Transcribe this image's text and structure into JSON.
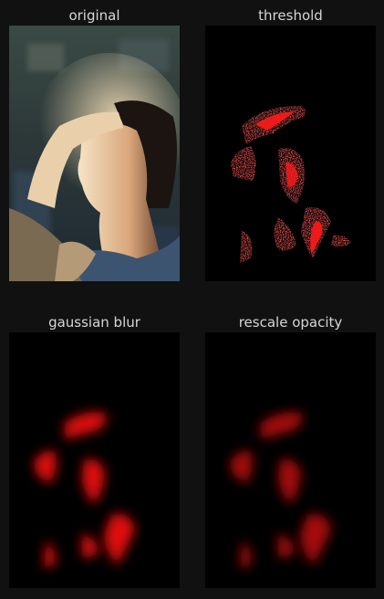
{
  "panels": [
    {
      "title": "original"
    },
    {
      "title": "threshold"
    },
    {
      "title": "gaussian blur"
    },
    {
      "title": "rescale opacity"
    }
  ],
  "colors": {
    "background": "#111111",
    "title_text": "#d6d6d6",
    "mask_red": "#ff1a1a",
    "image_black": "#000000"
  }
}
